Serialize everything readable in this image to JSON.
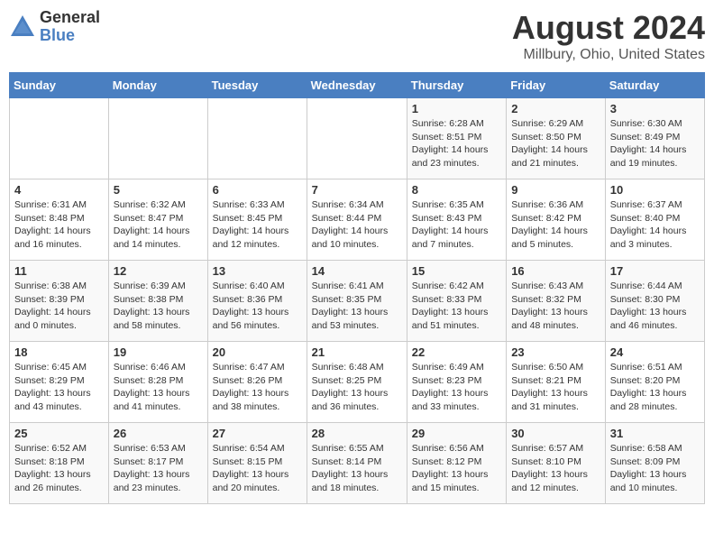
{
  "header": {
    "logo_general": "General",
    "logo_blue": "Blue",
    "month_year": "August 2024",
    "location": "Millbury, Ohio, United States"
  },
  "days_of_week": [
    "Sunday",
    "Monday",
    "Tuesday",
    "Wednesday",
    "Thursday",
    "Friday",
    "Saturday"
  ],
  "weeks": [
    [
      {
        "day": "",
        "info": ""
      },
      {
        "day": "",
        "info": ""
      },
      {
        "day": "",
        "info": ""
      },
      {
        "day": "",
        "info": ""
      },
      {
        "day": "1",
        "info": "Sunrise: 6:28 AM\nSunset: 8:51 PM\nDaylight: 14 hours\nand 23 minutes."
      },
      {
        "day": "2",
        "info": "Sunrise: 6:29 AM\nSunset: 8:50 PM\nDaylight: 14 hours\nand 21 minutes."
      },
      {
        "day": "3",
        "info": "Sunrise: 6:30 AM\nSunset: 8:49 PM\nDaylight: 14 hours\nand 19 minutes."
      }
    ],
    [
      {
        "day": "4",
        "info": "Sunrise: 6:31 AM\nSunset: 8:48 PM\nDaylight: 14 hours\nand 16 minutes."
      },
      {
        "day": "5",
        "info": "Sunrise: 6:32 AM\nSunset: 8:47 PM\nDaylight: 14 hours\nand 14 minutes."
      },
      {
        "day": "6",
        "info": "Sunrise: 6:33 AM\nSunset: 8:45 PM\nDaylight: 14 hours\nand 12 minutes."
      },
      {
        "day": "7",
        "info": "Sunrise: 6:34 AM\nSunset: 8:44 PM\nDaylight: 14 hours\nand 10 minutes."
      },
      {
        "day": "8",
        "info": "Sunrise: 6:35 AM\nSunset: 8:43 PM\nDaylight: 14 hours\nand 7 minutes."
      },
      {
        "day": "9",
        "info": "Sunrise: 6:36 AM\nSunset: 8:42 PM\nDaylight: 14 hours\nand 5 minutes."
      },
      {
        "day": "10",
        "info": "Sunrise: 6:37 AM\nSunset: 8:40 PM\nDaylight: 14 hours\nand 3 minutes."
      }
    ],
    [
      {
        "day": "11",
        "info": "Sunrise: 6:38 AM\nSunset: 8:39 PM\nDaylight: 14 hours\nand 0 minutes."
      },
      {
        "day": "12",
        "info": "Sunrise: 6:39 AM\nSunset: 8:38 PM\nDaylight: 13 hours\nand 58 minutes."
      },
      {
        "day": "13",
        "info": "Sunrise: 6:40 AM\nSunset: 8:36 PM\nDaylight: 13 hours\nand 56 minutes."
      },
      {
        "day": "14",
        "info": "Sunrise: 6:41 AM\nSunset: 8:35 PM\nDaylight: 13 hours\nand 53 minutes."
      },
      {
        "day": "15",
        "info": "Sunrise: 6:42 AM\nSunset: 8:33 PM\nDaylight: 13 hours\nand 51 minutes."
      },
      {
        "day": "16",
        "info": "Sunrise: 6:43 AM\nSunset: 8:32 PM\nDaylight: 13 hours\nand 48 minutes."
      },
      {
        "day": "17",
        "info": "Sunrise: 6:44 AM\nSunset: 8:30 PM\nDaylight: 13 hours\nand 46 minutes."
      }
    ],
    [
      {
        "day": "18",
        "info": "Sunrise: 6:45 AM\nSunset: 8:29 PM\nDaylight: 13 hours\nand 43 minutes."
      },
      {
        "day": "19",
        "info": "Sunrise: 6:46 AM\nSunset: 8:28 PM\nDaylight: 13 hours\nand 41 minutes."
      },
      {
        "day": "20",
        "info": "Sunrise: 6:47 AM\nSunset: 8:26 PM\nDaylight: 13 hours\nand 38 minutes."
      },
      {
        "day": "21",
        "info": "Sunrise: 6:48 AM\nSunset: 8:25 PM\nDaylight: 13 hours\nand 36 minutes."
      },
      {
        "day": "22",
        "info": "Sunrise: 6:49 AM\nSunset: 8:23 PM\nDaylight: 13 hours\nand 33 minutes."
      },
      {
        "day": "23",
        "info": "Sunrise: 6:50 AM\nSunset: 8:21 PM\nDaylight: 13 hours\nand 31 minutes."
      },
      {
        "day": "24",
        "info": "Sunrise: 6:51 AM\nSunset: 8:20 PM\nDaylight: 13 hours\nand 28 minutes."
      }
    ],
    [
      {
        "day": "25",
        "info": "Sunrise: 6:52 AM\nSunset: 8:18 PM\nDaylight: 13 hours\nand 26 minutes."
      },
      {
        "day": "26",
        "info": "Sunrise: 6:53 AM\nSunset: 8:17 PM\nDaylight: 13 hours\nand 23 minutes."
      },
      {
        "day": "27",
        "info": "Sunrise: 6:54 AM\nSunset: 8:15 PM\nDaylight: 13 hours\nand 20 minutes."
      },
      {
        "day": "28",
        "info": "Sunrise: 6:55 AM\nSunset: 8:14 PM\nDaylight: 13 hours\nand 18 minutes."
      },
      {
        "day": "29",
        "info": "Sunrise: 6:56 AM\nSunset: 8:12 PM\nDaylight: 13 hours\nand 15 minutes."
      },
      {
        "day": "30",
        "info": "Sunrise: 6:57 AM\nSunset: 8:10 PM\nDaylight: 13 hours\nand 12 minutes."
      },
      {
        "day": "31",
        "info": "Sunrise: 6:58 AM\nSunset: 8:09 PM\nDaylight: 13 hours\nand 10 minutes."
      }
    ]
  ]
}
